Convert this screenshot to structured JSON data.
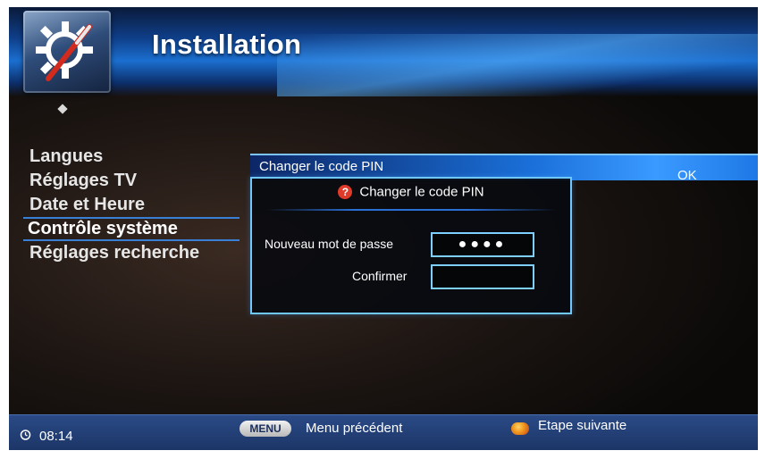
{
  "header": {
    "title": "Installation",
    "logo_icon": "gear-screwdriver-icon"
  },
  "menu": {
    "items": [
      {
        "label": "Langues"
      },
      {
        "label": "Réglages TV"
      },
      {
        "label": "Date et Heure"
      },
      {
        "label": "Contrôle système",
        "selected": true
      },
      {
        "label": "Réglages recherche"
      }
    ]
  },
  "option_row": {
    "label": "Changer le code PIN",
    "value": "OK"
  },
  "dialog": {
    "title": "Changer le code PIN",
    "icon": "question-icon",
    "new_password_label": "Nouveau mot de passe",
    "new_password_value": "●●●●",
    "confirm_label": "Confirmer",
    "confirm_value": ""
  },
  "footer": {
    "time": "08:14",
    "menu_key": "MENU",
    "menu_action": "Menu précédent",
    "next_action": "Etape suivante"
  },
  "colors": {
    "accent_blue": "#1a6fd8",
    "dialog_border": "#6fc8ff",
    "footer_bg": "#2a4a86",
    "selection_line": "#3a7fd6",
    "orange_key": "#f29a1e"
  }
}
